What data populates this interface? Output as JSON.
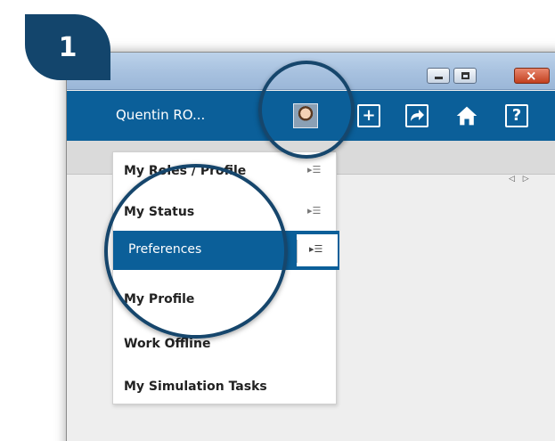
{
  "callout": {
    "number": "1"
  },
  "window": {
    "controls": {
      "minimize": "minimize",
      "maximize": "maximize",
      "close": "close"
    }
  },
  "toolbar": {
    "user_name": "Quentin RO...",
    "icons": [
      "user-avatar",
      "add-icon",
      "share-arrow-icon",
      "home-icon",
      "help-icon"
    ],
    "help_glyph": "?",
    "add_glyph": "+"
  },
  "strip": {
    "nav_arrows": "◁ ▷"
  },
  "menu": {
    "items": [
      {
        "label": "My Roles / Profile",
        "submenu": "▸☰"
      },
      {
        "label": "My Status",
        "submenu": "▸☰"
      },
      {
        "label": "Preferences",
        "submenu": "▸☰",
        "selected": true
      },
      {
        "label": "My Profile"
      },
      {
        "label": "Work Offline"
      },
      {
        "label": "My Simulation Tasks"
      }
    ]
  },
  "colors": {
    "accent": "#0b5f99",
    "callout": "#13456c"
  }
}
